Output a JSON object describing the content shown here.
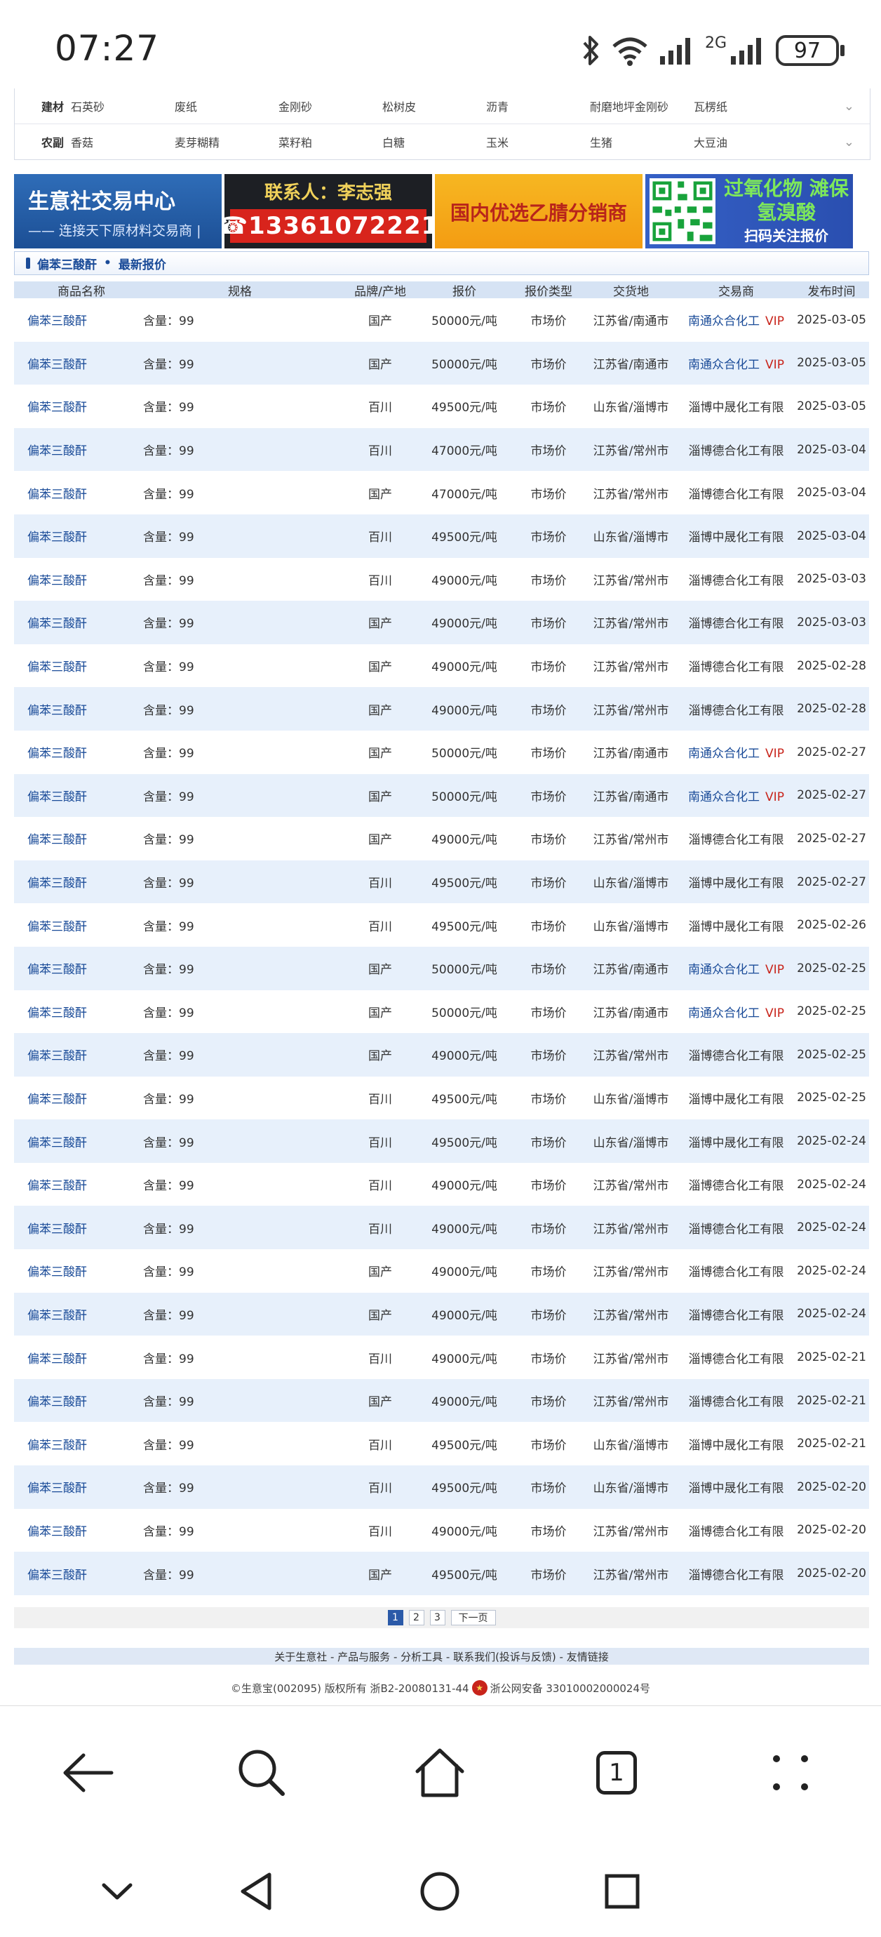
{
  "status_bar": {
    "time": "07:27",
    "network_label": "2G",
    "battery": "97"
  },
  "categories": [
    {
      "name": "建材",
      "items": [
        "石英砂",
        "废纸",
        "金刚砂",
        "松树皮",
        "沥青",
        "耐磨地坪金刚砂",
        "瓦楞纸"
      ]
    },
    {
      "name": "农副",
      "items": [
        "香菇",
        "麦芽糊精",
        "菜籽粕",
        "白糖",
        "玉米",
        "生猪",
        "大豆油"
      ]
    }
  ],
  "banners": {
    "b1_title": "生意社交易中心",
    "b1_sub": "—— 连接天下原材料交易商 |",
    "b2_contact": "联系人：李志强",
    "b2_phone": "☎13361072221",
    "b3_text": "国内优选乙腈分销商",
    "b4_title": "过氧化物 滩保氢溴酸",
    "b4_sub": "扫码关注报价"
  },
  "section": {
    "product": "偏苯三酸酐",
    "dot": "•",
    "title": "最新报价"
  },
  "table": {
    "headers": [
      "商品名称",
      "规格",
      "品牌/产地",
      "报价",
      "报价类型",
      "交货地",
      "交易商",
      "发布时间"
    ],
    "rows": [
      [
        "偏苯三酸酐",
        "含量：99",
        "国产",
        "50000元/吨",
        "市场价",
        "江苏省/南通市",
        "南通众合化工",
        "VIP",
        "2025-03-05"
      ],
      [
        "偏苯三酸酐",
        "含量：99",
        "国产",
        "50000元/吨",
        "市场价",
        "江苏省/南通市",
        "南通众合化工",
        "VIP",
        "2025-03-05"
      ],
      [
        "偏苯三酸酐",
        "含量：99",
        "百川",
        "49500元/吨",
        "市场价",
        "山东省/淄博市",
        "淄博中晟化工有限",
        "",
        "2025-03-05"
      ],
      [
        "偏苯三酸酐",
        "含量：99",
        "百川",
        "47000元/吨",
        "市场价",
        "江苏省/常州市",
        "淄博德合化工有限",
        "",
        "2025-03-04"
      ],
      [
        "偏苯三酸酐",
        "含量：99",
        "国产",
        "47000元/吨",
        "市场价",
        "江苏省/常州市",
        "淄博德合化工有限",
        "",
        "2025-03-04"
      ],
      [
        "偏苯三酸酐",
        "含量：99",
        "百川",
        "49500元/吨",
        "市场价",
        "山东省/淄博市",
        "淄博中晟化工有限",
        "",
        "2025-03-04"
      ],
      [
        "偏苯三酸酐",
        "含量：99",
        "百川",
        "49000元/吨",
        "市场价",
        "江苏省/常州市",
        "淄博德合化工有限",
        "",
        "2025-03-03"
      ],
      [
        "偏苯三酸酐",
        "含量：99",
        "国产",
        "49000元/吨",
        "市场价",
        "江苏省/常州市",
        "淄博德合化工有限",
        "",
        "2025-03-03"
      ],
      [
        "偏苯三酸酐",
        "含量：99",
        "国产",
        "49000元/吨",
        "市场价",
        "江苏省/常州市",
        "淄博德合化工有限",
        "",
        "2025-02-28"
      ],
      [
        "偏苯三酸酐",
        "含量：99",
        "国产",
        "49000元/吨",
        "市场价",
        "江苏省/常州市",
        "淄博德合化工有限",
        "",
        "2025-02-28"
      ],
      [
        "偏苯三酸酐",
        "含量：99",
        "国产",
        "50000元/吨",
        "市场价",
        "江苏省/南通市",
        "南通众合化工",
        "VIP",
        "2025-02-27"
      ],
      [
        "偏苯三酸酐",
        "含量：99",
        "国产",
        "50000元/吨",
        "市场价",
        "江苏省/南通市",
        "南通众合化工",
        "VIP",
        "2025-02-27"
      ],
      [
        "偏苯三酸酐",
        "含量：99",
        "国产",
        "49000元/吨",
        "市场价",
        "江苏省/常州市",
        "淄博德合化工有限",
        "",
        "2025-02-27"
      ],
      [
        "偏苯三酸酐",
        "含量：99",
        "百川",
        "49500元/吨",
        "市场价",
        "山东省/淄博市",
        "淄博中晟化工有限",
        "",
        "2025-02-27"
      ],
      [
        "偏苯三酸酐",
        "含量：99",
        "百川",
        "49500元/吨",
        "市场价",
        "山东省/淄博市",
        "淄博中晟化工有限",
        "",
        "2025-02-26"
      ],
      [
        "偏苯三酸酐",
        "含量：99",
        "国产",
        "50000元/吨",
        "市场价",
        "江苏省/南通市",
        "南通众合化工",
        "VIP",
        "2025-02-25"
      ],
      [
        "偏苯三酸酐",
        "含量：99",
        "国产",
        "50000元/吨",
        "市场价",
        "江苏省/南通市",
        "南通众合化工",
        "VIP",
        "2025-02-25"
      ],
      [
        "偏苯三酸酐",
        "含量：99",
        "国产",
        "49000元/吨",
        "市场价",
        "江苏省/常州市",
        "淄博德合化工有限",
        "",
        "2025-02-25"
      ],
      [
        "偏苯三酸酐",
        "含量：99",
        "百川",
        "49500元/吨",
        "市场价",
        "山东省/淄博市",
        "淄博中晟化工有限",
        "",
        "2025-02-25"
      ],
      [
        "偏苯三酸酐",
        "含量：99",
        "百川",
        "49500元/吨",
        "市场价",
        "山东省/淄博市",
        "淄博中晟化工有限",
        "",
        "2025-02-24"
      ],
      [
        "偏苯三酸酐",
        "含量：99",
        "百川",
        "49000元/吨",
        "市场价",
        "江苏省/常州市",
        "淄博德合化工有限",
        "",
        "2025-02-24"
      ],
      [
        "偏苯三酸酐",
        "含量：99",
        "百川",
        "49000元/吨",
        "市场价",
        "江苏省/常州市",
        "淄博德合化工有限",
        "",
        "2025-02-24"
      ],
      [
        "偏苯三酸酐",
        "含量：99",
        "国产",
        "49000元/吨",
        "市场价",
        "江苏省/常州市",
        "淄博德合化工有限",
        "",
        "2025-02-24"
      ],
      [
        "偏苯三酸酐",
        "含量：99",
        "国产",
        "49000元/吨",
        "市场价",
        "江苏省/常州市",
        "淄博德合化工有限",
        "",
        "2025-02-24"
      ],
      [
        "偏苯三酸酐",
        "含量：99",
        "百川",
        "49000元/吨",
        "市场价",
        "江苏省/常州市",
        "淄博德合化工有限",
        "",
        "2025-02-21"
      ],
      [
        "偏苯三酸酐",
        "含量：99",
        "国产",
        "49000元/吨",
        "市场价",
        "江苏省/常州市",
        "淄博德合化工有限",
        "",
        "2025-02-21"
      ],
      [
        "偏苯三酸酐",
        "含量：99",
        "百川",
        "49500元/吨",
        "市场价",
        "山东省/淄博市",
        "淄博中晟化工有限",
        "",
        "2025-02-21"
      ],
      [
        "偏苯三酸酐",
        "含量：99",
        "百川",
        "49500元/吨",
        "市场价",
        "山东省/淄博市",
        "淄博中晟化工有限",
        "",
        "2025-02-20"
      ],
      [
        "偏苯三酸酐",
        "含量：99",
        "百川",
        "49000元/吨",
        "市场价",
        "江苏省/常州市",
        "淄博德合化工有限",
        "",
        "2025-02-20"
      ],
      [
        "偏苯三酸酐",
        "含量：99",
        "国产",
        "49500元/吨",
        "市场价",
        "江苏省/常州市",
        "淄博德合化工有限",
        "",
        "2025-02-20"
      ]
    ]
  },
  "pagination": {
    "pages": [
      "1",
      "2",
      "3"
    ],
    "active": "1",
    "next": "下一页"
  },
  "footer": {
    "nav": "关于生意社 - 产品与服务 - 分析工具 - 联系我们(投诉与反馈) - 友情链接",
    "copyright": "©生意宝(002095) 版权所有 浙B2-20080131-44",
    "police": "浙公网安备 33010002000024号"
  },
  "browser": {
    "tab_count": "1"
  },
  "colors": {
    "link": "#1a4b98",
    "vip": "#c8241b",
    "row_alt": "#e7f0fb",
    "header_bg": "#d6e3f4"
  },
  "icons": [
    "bluetooth-icon",
    "wifi-icon",
    "signal-icon",
    "battery-icon",
    "back-arrow-icon",
    "search-icon",
    "home-icon",
    "tabs-icon",
    "menu-dots-icon",
    "nav-down-icon",
    "nav-back-icon",
    "nav-home-icon",
    "nav-recents-icon"
  ]
}
